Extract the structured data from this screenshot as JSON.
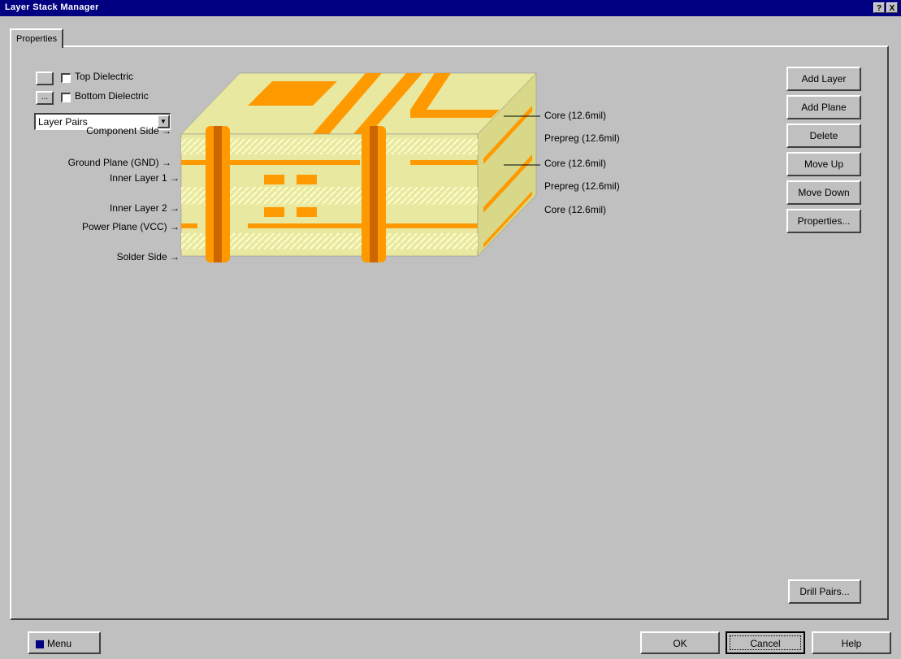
{
  "window": {
    "title": "Layer Stack Manager",
    "help_btn": "?",
    "close_btn": "X"
  },
  "tabs": [
    {
      "label": "Properties"
    }
  ],
  "options": {
    "top_dielectric": "Top Dielectric",
    "bottom_dielectric": "Bottom Dielectric",
    "ellipsis": "...",
    "layer_pairs": "Layer Pairs"
  },
  "left_layers": [
    "Component Side",
    "Ground Plane (GND)",
    "Inner Layer 1",
    "Inner Layer 2",
    "Power Plane (VCC)",
    "Solder Side"
  ],
  "right_layers": [
    "Core (12.6mil)",
    "Prepreg (12.6mil)",
    "Core (12.6mil)",
    "Prepreg (12.6mil)",
    "Core (12.6mil)"
  ],
  "side_buttons": [
    "Add Layer",
    "Add Plane",
    "Delete",
    "Move Up",
    "Move Down",
    "Properties..."
  ],
  "drill_pairs": "Drill Pairs...",
  "bottom": {
    "menu": "Menu",
    "ok": "OK",
    "cancel": "Cancel",
    "help": "Help"
  },
  "colors": {
    "copper": "#ff9900",
    "dielectric": "#e8e8a0",
    "titlebar": "#000080"
  }
}
